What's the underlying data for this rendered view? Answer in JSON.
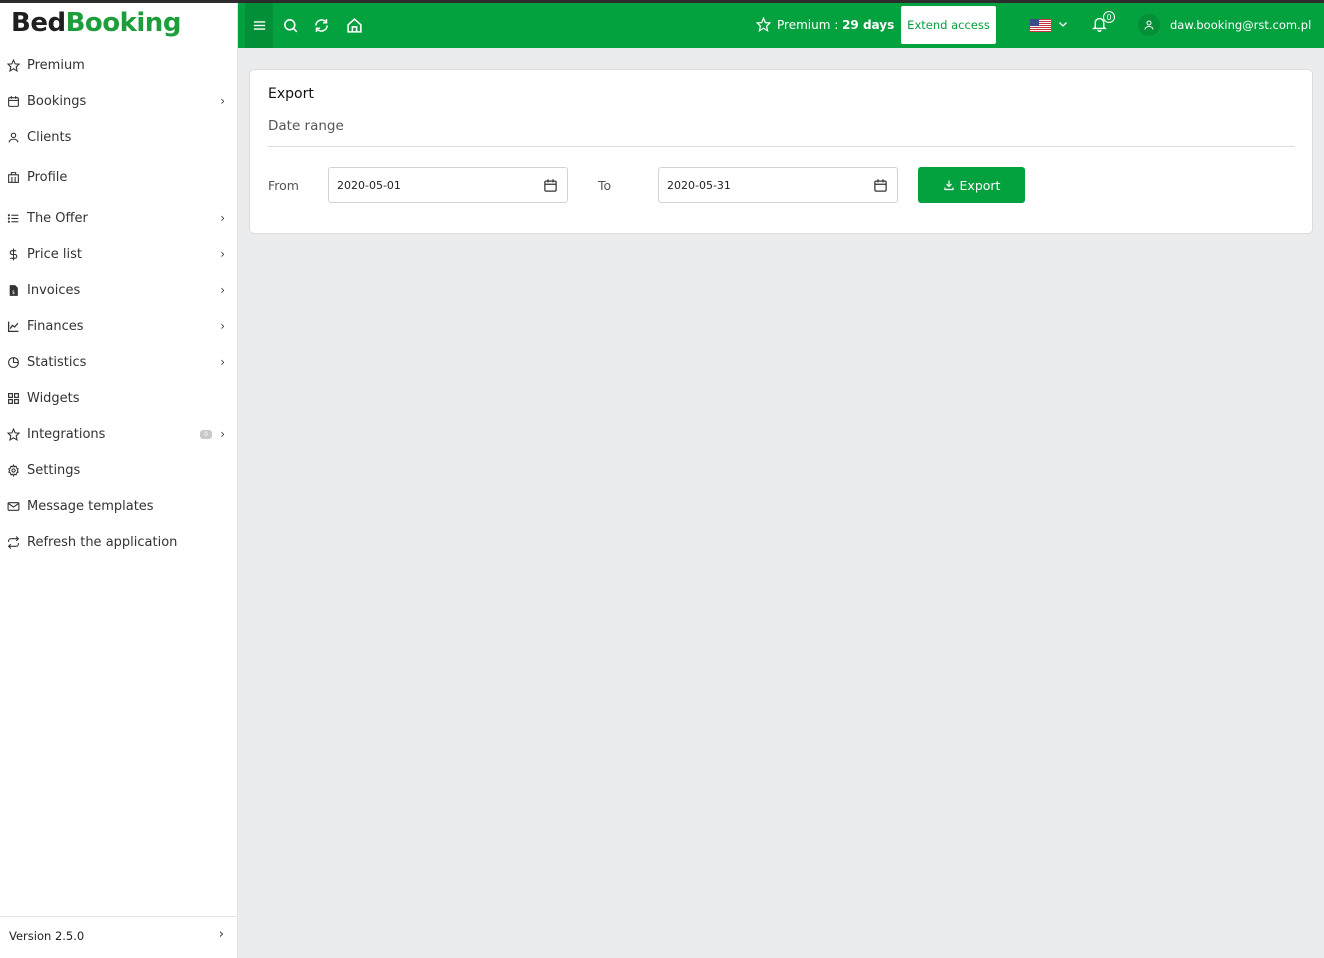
{
  "app": {
    "logo_part1": "Bed",
    "logo_part2": "Booking"
  },
  "sidebar": {
    "items": [
      {
        "label": "Premium",
        "icon": "star-icon",
        "has_chevron": false
      },
      {
        "label": "Bookings",
        "icon": "calendar-icon",
        "has_chevron": true
      },
      {
        "label": "Clients",
        "icon": "user-icon",
        "has_chevron": false
      },
      {
        "label": "Profile",
        "icon": "building-icon",
        "has_chevron": false
      },
      {
        "label": "The Offer",
        "icon": "list-icon",
        "has_chevron": true
      },
      {
        "label": "Price list",
        "icon": "dollar-icon",
        "has_chevron": true
      },
      {
        "label": "Invoices",
        "icon": "invoice-icon",
        "has_chevron": true
      },
      {
        "label": "Finances",
        "icon": "chart-line-icon",
        "has_chevron": true
      },
      {
        "label": "Statistics",
        "icon": "pie-chart-icon",
        "has_chevron": true
      },
      {
        "label": "Widgets",
        "icon": "grid-icon",
        "has_chevron": false
      },
      {
        "label": "Integrations",
        "icon": "star-icon",
        "has_chevron": true,
        "badge": "0"
      },
      {
        "label": "Settings",
        "icon": "gear-icon",
        "has_chevron": false
      },
      {
        "label": "Message templates",
        "icon": "envelope-icon",
        "has_chevron": false
      },
      {
        "label": "Refresh the application",
        "icon": "refresh-icon",
        "has_chevron": false
      }
    ],
    "version": "Version 2.5.0"
  },
  "topbar": {
    "premium_label": "Premium : ",
    "premium_days": "29 days",
    "extend_label": "Extend access",
    "notifications_count": "0",
    "user_email": "daw.booking@rst.com.pl",
    "language_flag": "us-flag-icon"
  },
  "export": {
    "title": "Export",
    "subtitle": "Date range",
    "from_label": "From",
    "from_value": "2020-05-01",
    "to_label": "To",
    "to_value": "2020-05-31",
    "button_label": "Export"
  },
  "colors": {
    "brand": "#04a13f",
    "brand_dark": "#038f37",
    "background": "#ebecee"
  }
}
